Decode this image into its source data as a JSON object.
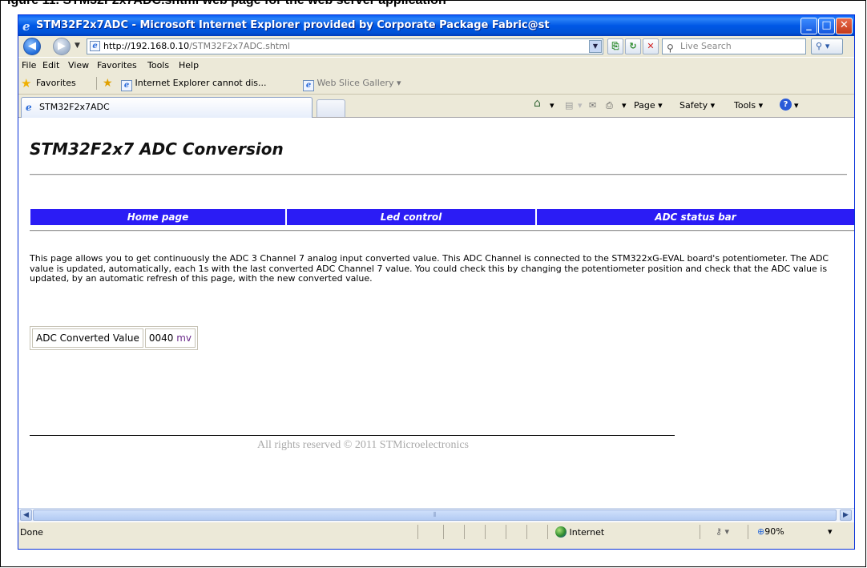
{
  "caption": "igure 11.  STM32F2x7ADC.shtml web page for the web server application",
  "window": {
    "title": "STM32F2x7ADC - Microsoft Internet Explorer provided by Corporate Package Fabric@st",
    "minimize": "_",
    "maximize": "□",
    "close": "✕"
  },
  "address": {
    "host": "http://192.168.0.10",
    "path": "/STM32F2x7ADC.shtml",
    "search_placeholder": "Live Search"
  },
  "menu": [
    "File",
    "Edit",
    "View",
    "Favorites",
    "Tools",
    "Help"
  ],
  "favorites": {
    "label": "Favorites",
    "link1": "Internet Explorer cannot dis...",
    "link2": "Web Slice Gallery ▾"
  },
  "tab": {
    "label": "STM32F2x7ADC"
  },
  "commands": {
    "page": "Page ▾",
    "safety": "Safety ▾",
    "tools": "Tools ▾"
  },
  "page": {
    "heading": "STM32F2x7 ADC Conversion",
    "nav": [
      "Home page",
      "Led control",
      "ADC status bar"
    ],
    "paragraph": "This page allows you to get continuously the ADC 3 Channel 7 analog input converted value. This ADC Channel is connected to the STM322xG-EVAL board's potentiometer. The ADC value is updated, automatically, each 1s with the last converted ADC Channel 7 value. You could check this by changing the potentiometer position and check that the ADC value is updated, by an automatic refresh of this page, with the new converted value.",
    "adc_label": "ADC Converted Value",
    "adc_value": "0040",
    "adc_unit": "mv",
    "copyright": "All rights reserved © 2011 STMicroelectronics"
  },
  "status": {
    "text": "Done",
    "zone": "Internet",
    "zoom": "90%"
  }
}
